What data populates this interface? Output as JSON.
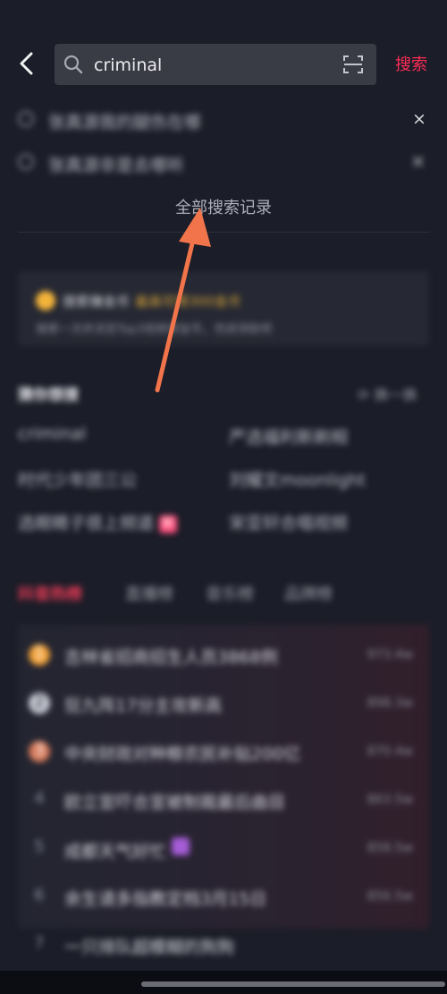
{
  "search": {
    "query": "criminal",
    "button_label": "搜索"
  },
  "history": {
    "items": [
      "张真源我的腿伤在哪",
      "张真源非是去哪听"
    ],
    "clear_x": "×",
    "all_label": "全部搜索记录"
  },
  "coin_card": {
    "title": "搜索赚金币",
    "highlight": "最高可得300金币",
    "subtitle": "搜索一次并浏览Top3视频得金币，完成领取吧"
  },
  "guess": {
    "title": "猜你想搜",
    "refresh_label": "换一换",
    "items": [
      "criminal",
      "严选福利新刷相",
      "时代少年团三公",
      "刘耀文moonlight",
      "选眼睛子很上频道",
      "宋亚轩合唱视频"
    ]
  },
  "tabs": [
    "抖音热榜",
    "直播榜",
    "音乐榜",
    "品牌榜"
  ],
  "hot_list": [
    {
      "rank": "1",
      "title": "吉林省招商招生人员3868例",
      "heat": "973.4w"
    },
    {
      "rank": "2",
      "title": "狂九阵17分主攻新高",
      "heat": "898.3w"
    },
    {
      "rank": "3",
      "title": "中央财政对种粮农民补贴200亿",
      "heat": "870.4w"
    },
    {
      "rank": "4",
      "title": "欧立宣吓合宣被制裁最后曲目",
      "heat": "863.5w"
    },
    {
      "rank": "5",
      "title": "成都天气好忙",
      "heat": "858.5w"
    },
    {
      "rank": "6",
      "title": "余生请多指教定档3月15日",
      "heat": "856.5w"
    },
    {
      "rank": "7",
      "title": "一只排队超模糊的狗狗",
      "heat": ""
    }
  ],
  "colors": {
    "accent": "#fe2c55",
    "background": "#1b1d28",
    "arrow": "#f2744a"
  },
  "icons": {
    "back": "chevron-left-icon",
    "search": "search-icon",
    "scan": "scan-icon",
    "clock": "clock-icon",
    "coin": "coin-icon",
    "refresh": "refresh-icon"
  }
}
